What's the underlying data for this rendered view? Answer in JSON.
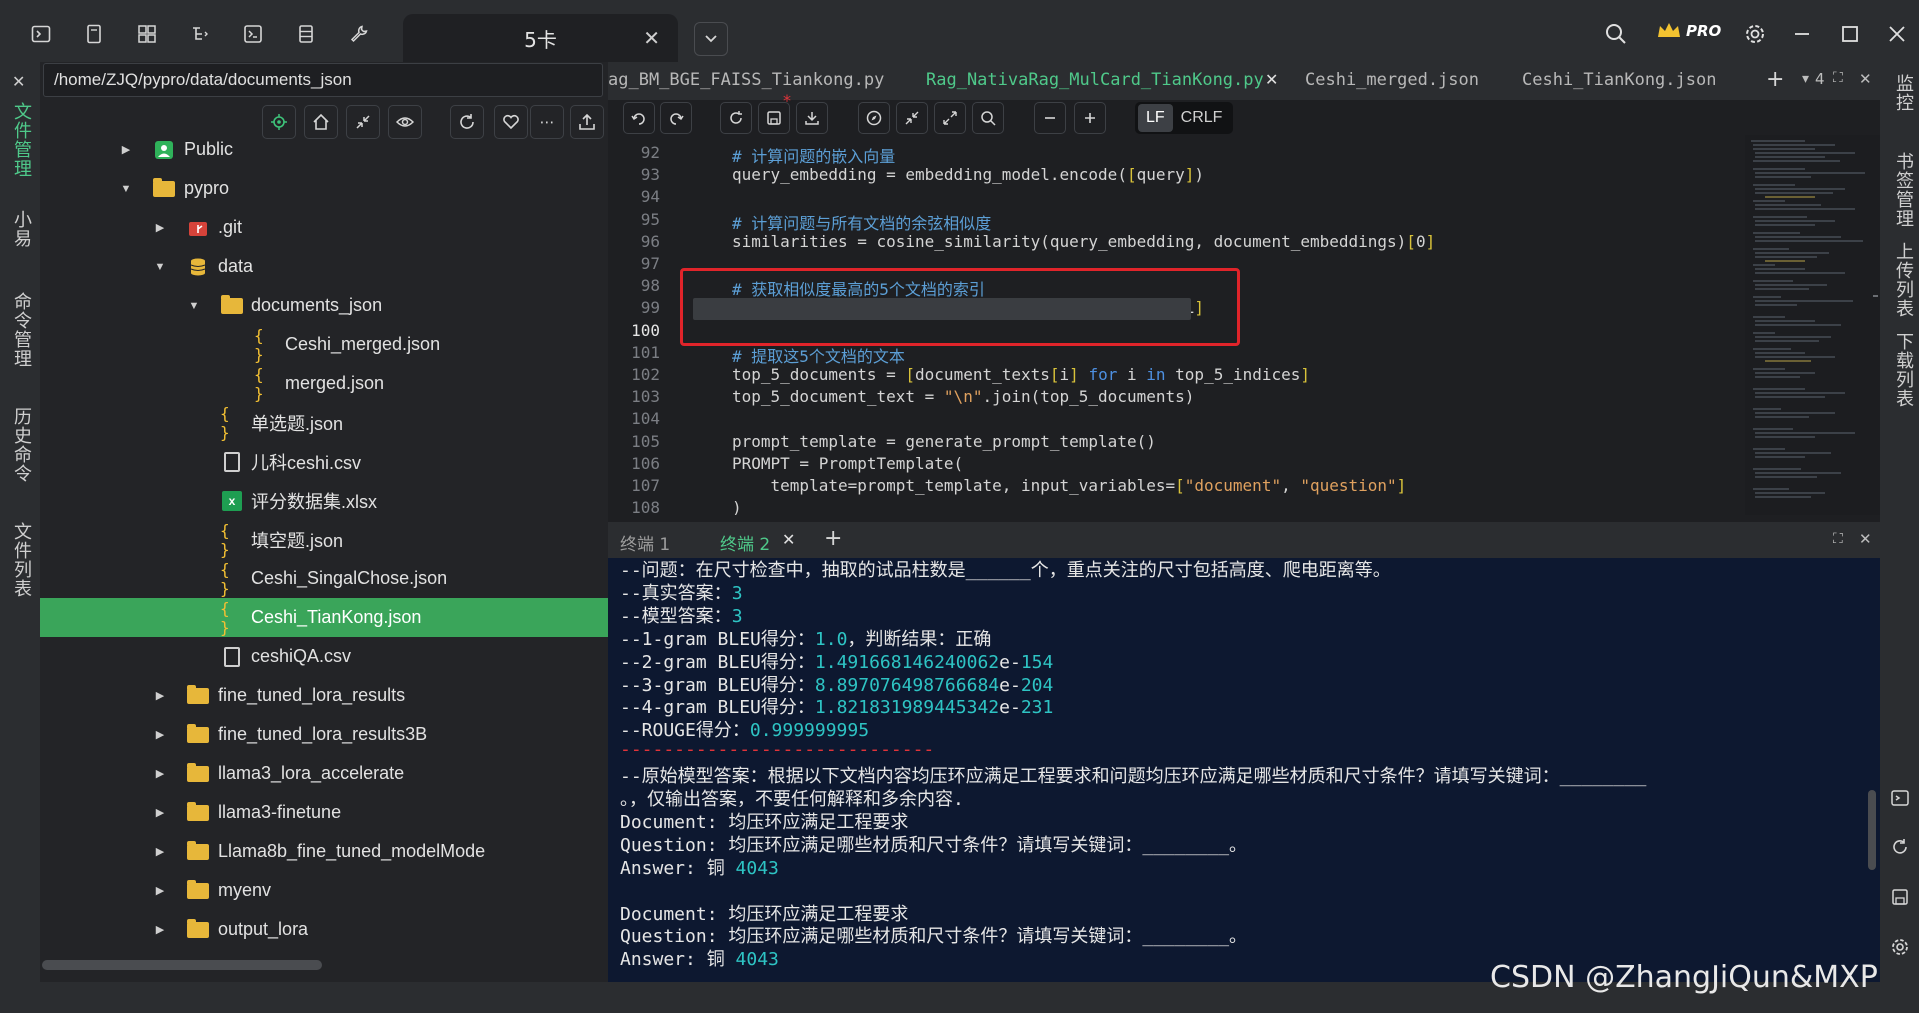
{
  "window": {
    "tab_title": "5卡",
    "pro_badge": "PRO"
  },
  "left_rail": [
    "文件管理",
    "小易",
    "命令管理",
    "历史命令",
    "文件列表"
  ],
  "right_rail": [
    "监控",
    "书签管理",
    "上传列表",
    "下载列表"
  ],
  "file_panel": {
    "path": "/home/ZJQ/pypro/data/documents_json",
    "tree": [
      {
        "label": "Public",
        "type": "public",
        "depth": 1,
        "arrow": "right"
      },
      {
        "label": "pypro",
        "type": "folder",
        "depth": 1,
        "arrow": "down"
      },
      {
        "label": ".git",
        "type": "git",
        "depth": 2,
        "arrow": "right"
      },
      {
        "label": "data",
        "type": "db",
        "depth": 2,
        "arrow": "down"
      },
      {
        "label": "documents_json",
        "type": "folder",
        "depth": 3,
        "arrow": "down"
      },
      {
        "label": "Ceshi_merged.json",
        "type": "json",
        "depth": 4,
        "arrow": ""
      },
      {
        "label": "merged.json",
        "type": "json",
        "depth": 4,
        "arrow": ""
      },
      {
        "label": "单选题.json",
        "type": "json",
        "depth": 3,
        "arrow": ""
      },
      {
        "label": "儿科ceshi.csv",
        "type": "csv",
        "depth": 3,
        "arrow": ""
      },
      {
        "label": "评分数据集.xlsx",
        "type": "xlsx",
        "depth": 3,
        "arrow": ""
      },
      {
        "label": "填空题.json",
        "type": "json",
        "depth": 3,
        "arrow": ""
      },
      {
        "label": "Ceshi_SingalChose.json",
        "type": "json",
        "depth": 3,
        "arrow": ""
      },
      {
        "label": "Ceshi_TianKong.json",
        "type": "json",
        "depth": 3,
        "arrow": "",
        "selected": true
      },
      {
        "label": "ceshiQA.csv",
        "type": "csv",
        "depth": 3,
        "arrow": ""
      },
      {
        "label": "fine_tuned_lora_results",
        "type": "folder",
        "depth": 2,
        "arrow": "right"
      },
      {
        "label": "fine_tuned_lora_results3B",
        "type": "folder",
        "depth": 2,
        "arrow": "right"
      },
      {
        "label": "llama3_lora_accelerate",
        "type": "folder",
        "depth": 2,
        "arrow": "right"
      },
      {
        "label": "llama3-finetune",
        "type": "folder",
        "depth": 2,
        "arrow": "right"
      },
      {
        "label": "Llama8b_fine_tuned_modelMode",
        "type": "folder",
        "depth": 2,
        "arrow": "right"
      },
      {
        "label": "myenv",
        "type": "folder",
        "depth": 2,
        "arrow": "right"
      },
      {
        "label": "output_lora",
        "type": "folder",
        "depth": 2,
        "arrow": "right"
      }
    ]
  },
  "editor": {
    "tabs": [
      {
        "label": "ag_BM_BGE_FAISS_Tiankong.py",
        "active": false
      },
      {
        "label": "Rag_NativaRag_MulCard_TianKong.py",
        "active": true
      },
      {
        "label": "Ceshi_merged.json",
        "active": false
      },
      {
        "label": "Ceshi_TianKong.json",
        "active": false
      }
    ],
    "tab_count": "4",
    "eol": {
      "lf": "LF",
      "crlf": "CRLF"
    },
    "lines": [
      {
        "n": "92",
        "html": "<span class=\"cm\"># 计算问题的嵌入向量</span>"
      },
      {
        "n": "93",
        "html": "query_embedding = embedding_model.encode(<span class=\"br\">[</span>query<span class=\"br\">]</span>)"
      },
      {
        "n": "94",
        "html": ""
      },
      {
        "n": "95",
        "html": "<span class=\"cm\"># 计算问题与所有文档的余弦相似度</span>"
      },
      {
        "n": "96",
        "html": "similarities = cosine_similarity(query_embedding, document_embeddings)<span class=\"br\">[</span>0<span class=\"br\">]</span>"
      },
      {
        "n": "97",
        "html": ""
      },
      {
        "n": "98",
        "html": "<span class=\"cm\"># 获取相似度最高的5个文档的索引</span>"
      },
      {
        "n": "99",
        "html": "top_5_indices = similarities.argsort()<span class=\"br\">[</span>-5:<span class=\"br\">][</span>::-1<span class=\"br\">]</span>"
      },
      {
        "n": "100",
        "html": "",
        "current": true
      },
      {
        "n": "101",
        "html": "<span class=\"cm\"># 提取这5个文档的文本</span>"
      },
      {
        "n": "102",
        "html": "top_5_documents = <span class=\"br\">[</span>document_texts<span class=\"br\">[</span>i<span class=\"br\">]</span> <span class=\"kw\">for</span> i <span class=\"kw\">in</span> top_5_indices<span class=\"br\">]</span>"
      },
      {
        "n": "103",
        "html": "top_5_document_text = <span class=\"st\">\"\\n\"</span>.join(top_5_documents)"
      },
      {
        "n": "104",
        "html": ""
      },
      {
        "n": "105",
        "html": "prompt_template = generate_prompt_template()"
      },
      {
        "n": "106",
        "html": "PROMPT = PromptTemplate("
      },
      {
        "n": "107",
        "html": "    template=prompt_template, input_variables=<span class=\"br\">[</span><span class=\"st\">\"document\"</span>, <span class=\"st\">\"question\"</span><span class=\"br\">]</span>"
      },
      {
        "n": "108",
        "html": ")"
      }
    ]
  },
  "terminal": {
    "tabs": [
      {
        "label": "终端 1",
        "active": false
      },
      {
        "label": "终端 2",
        "active": true
      }
    ],
    "lines": [
      "--问题：在尺寸检查中，抽取的试品柱数是______个，重点关注的尺寸包括高度、爬电距离等。",
      "--真实答案：<span class=\"num\">3</span>",
      "--模型答案：<span class=\"num\">3</span>",
      "--1-gram BLEU得分：<span class=\"num\">1.0</span>，判断结果：正确",
      "--2-gram BLEU得分：<span class=\"num\">1.491668146240062</span>e-<span class=\"num\">154</span>",
      "--3-gram BLEU得分：<span class=\"num\">8.897076498766684</span>e-<span class=\"num\">204</span>",
      "--4-gram BLEU得分：<span class=\"num\">1.821831989445342</span>e-<span class=\"num\">231</span>",
      "--ROUGE得分：<span class=\"num\">0.999999995</span>",
      "<span class=\"dash\">-----------------------------</span>",
      "--原始模型答案：根据以下文档内容均压环应满足工程要求和问题均压环应满足哪些材质和尺寸条件？请填写关键词：________",
      "。，仅输出答案，不要任何解释和多余内容.",
      "Document: 均压环应满足工程要求",
      "Question: 均压环应满足哪些材质和尺寸条件？请填写关键词：________。",
      "Answer: 铜 <span class=\"num\">4043</span>",
      "",
      "Document: 均压环应满足工程要求",
      "Question: 均压环应满足哪些材质和尺寸条件？请填写关键词：________。",
      "Answer: 铜 <span class=\"num\">4043</span>"
    ]
  },
  "watermark": "CSDN @ZhangJiQun&MXP"
}
